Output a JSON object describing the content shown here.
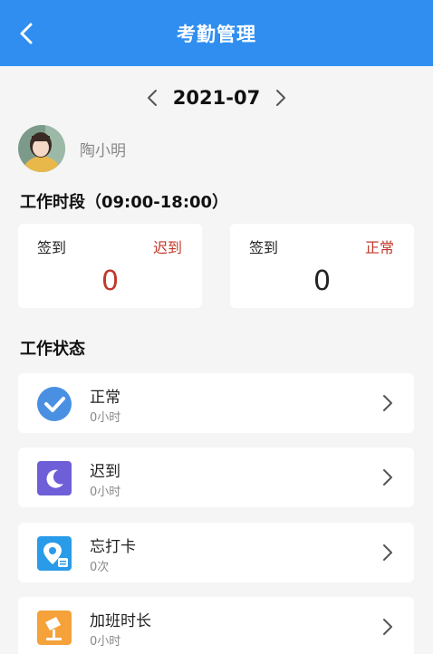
{
  "header": {
    "title": "考勤管理",
    "back_icon": "chevron-left-icon"
  },
  "month_nav": {
    "month": "2021-07",
    "prev_icon": "chevron-left-icon",
    "next_icon": "chevron-right-icon"
  },
  "user": {
    "name": "陶小明"
  },
  "work_period": {
    "title": "工作时段（09:00-18:00）",
    "cards": [
      {
        "label": "签到",
        "status": "迟到",
        "status_color": "#c0392b",
        "count": "0",
        "count_color": "#c0392b"
      },
      {
        "label": "签到",
        "status": "正常",
        "status_color": "#c0392b",
        "count": "0",
        "count_color": "#222222"
      }
    ]
  },
  "work_status": {
    "title": "工作状态",
    "items": [
      {
        "name": "正常",
        "value": "0小时",
        "icon": "check-circle-icon",
        "color": "#4a90e2"
      },
      {
        "name": "迟到",
        "value": "0小时",
        "icon": "moon-icon",
        "color": "#6e5fd8"
      },
      {
        "name": "忘打卡",
        "value": "0次",
        "icon": "location-pin-icon",
        "color": "#2a9be8"
      },
      {
        "name": "加班时长",
        "value": "0小时",
        "icon": "desk-lamp-icon",
        "color": "#f5a23a"
      }
    ]
  }
}
